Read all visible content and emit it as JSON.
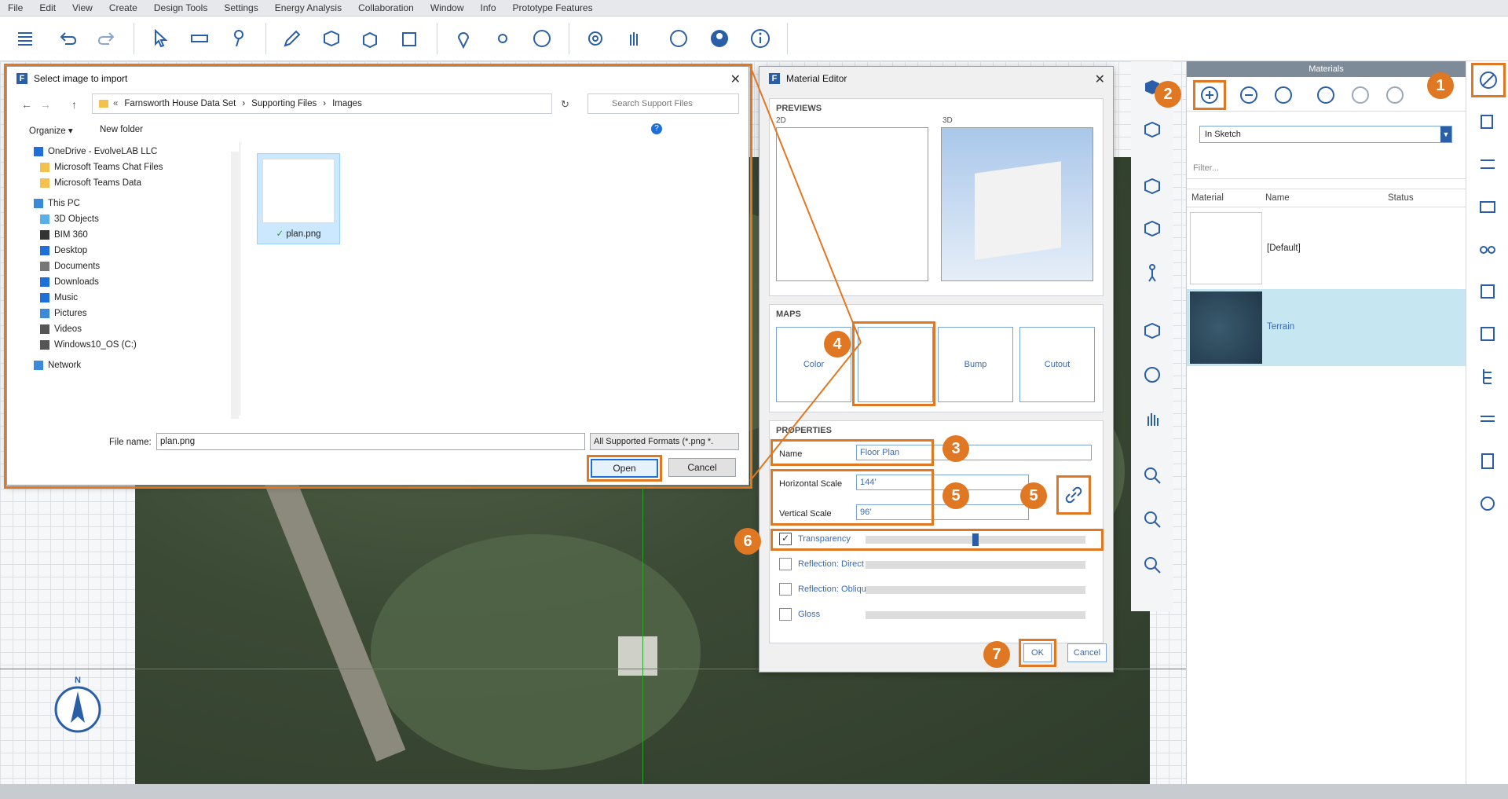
{
  "menu": [
    "File",
    "Edit",
    "View",
    "Create",
    "Design Tools",
    "Settings",
    "Energy Analysis",
    "Collaboration",
    "Window",
    "Info",
    "Prototype Features"
  ],
  "file_dialog": {
    "title": "Select image to import",
    "breadcrumb": [
      "Farnsworth House Data Set",
      "Supporting Files",
      "Images"
    ],
    "search_placeholder": "Search Support Files",
    "organize": "Organize",
    "new_folder": "New folder",
    "tree": [
      {
        "label": "OneDrive - EvolveLAB LLC",
        "icon": "cloud-icon"
      },
      {
        "label": "Microsoft Teams Chat Files",
        "icon": "folder-icon"
      },
      {
        "label": "Microsoft Teams Data",
        "icon": "folder-icon"
      },
      {
        "label": "This PC",
        "icon": "computer-icon"
      },
      {
        "label": "3D Objects",
        "icon": "cube-icon"
      },
      {
        "label": "BIM 360",
        "icon": "bim-icon"
      },
      {
        "label": "Desktop",
        "icon": "desktop-icon"
      },
      {
        "label": "Documents",
        "icon": "document-icon"
      },
      {
        "label": "Downloads",
        "icon": "download-icon"
      },
      {
        "label": "Music",
        "icon": "music-icon"
      },
      {
        "label": "Pictures",
        "icon": "picture-icon"
      },
      {
        "label": "Videos",
        "icon": "video-icon"
      },
      {
        "label": "Windows10_OS (C:)",
        "icon": "drive-icon"
      },
      {
        "label": "Network",
        "icon": "network-icon"
      }
    ],
    "file_item": "plan.png",
    "filename_label": "File name:",
    "filename_value": "plan.png",
    "filetype": "All Supported Formats (*.png *.",
    "open": "Open",
    "cancel": "Cancel"
  },
  "material_editor": {
    "title": "Material Editor",
    "previews": "PREVIEWS",
    "tab2d": "2D",
    "tab3d": "3D",
    "maps": "MAPS",
    "map_color": "Color",
    "map_bump": "Bump",
    "map_cutout": "Cutout",
    "properties": "PROPERTIES",
    "name_label": "Name",
    "name_value": "Floor Plan",
    "hscale_label": "Horizontal Scale",
    "hscale_value": "144'",
    "vscale_label": "Vertical Scale",
    "vscale_value": "96'",
    "transparency": "Transparency",
    "transparency_level": 0.5,
    "refl_direct": "Reflection: Direct",
    "refl_oblique": "Reflection: Oblique",
    "gloss": "Gloss",
    "ok": "OK",
    "cancel": "Cancel"
  },
  "materials_panel": {
    "title": "Materials",
    "dropdown": "In Sketch",
    "filter_placeholder": "Filter...",
    "columns": [
      "Material",
      "Name",
      "Status"
    ],
    "rows": [
      {
        "name": "[Default]"
      },
      {
        "name": "Terrain"
      }
    ]
  },
  "badges": [
    "1",
    "2",
    "3",
    "4",
    "5",
    "5",
    "6",
    "7"
  ],
  "compass": "N",
  "colors": {
    "accent": "#e07722",
    "selection": "#c6e6f2",
    "link": "#3a6bb1"
  }
}
